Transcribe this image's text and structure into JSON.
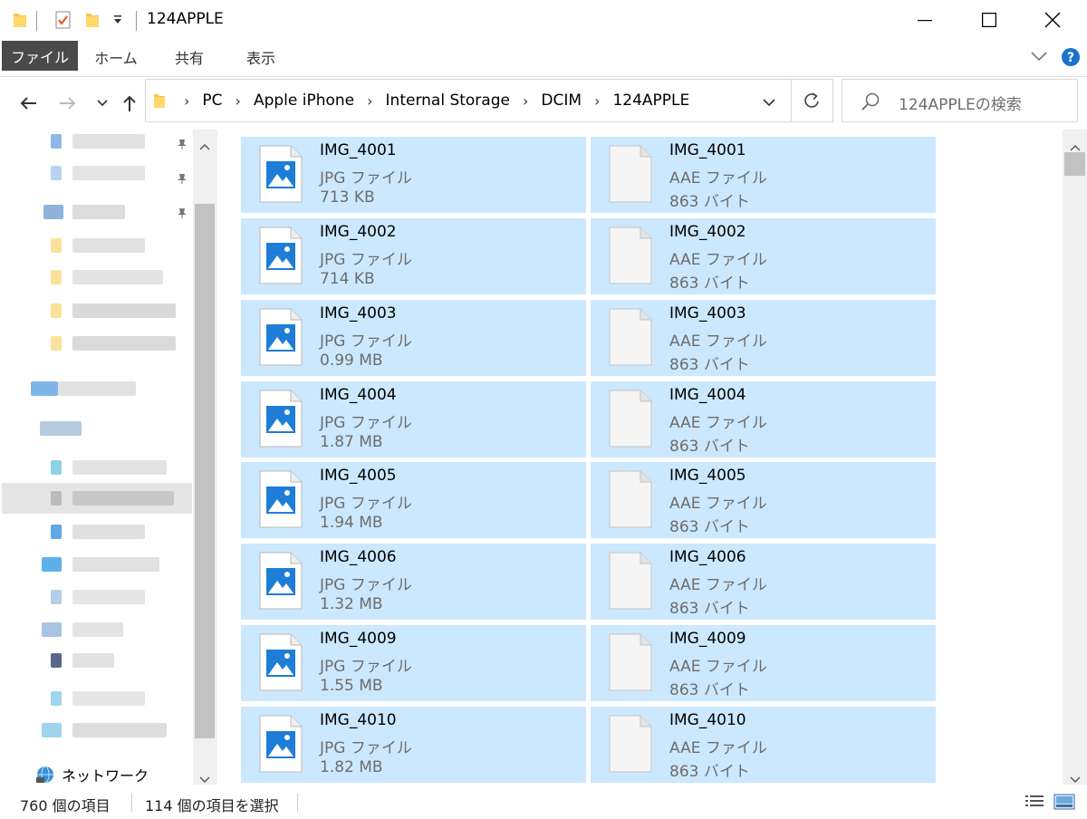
{
  "window": {
    "title": "124APPLE"
  },
  "ribbon": {
    "tabs": [
      "ファイル",
      "ホーム",
      "共有",
      "表示"
    ]
  },
  "address": {
    "crumbs": [
      "PC",
      "Apple iPhone",
      "Internal Storage",
      "DCIM",
      "124APPLE"
    ]
  },
  "search": {
    "placeholder": "124APPLEの検索"
  },
  "nav": {
    "network_label": "ネットワーク"
  },
  "files": [
    {
      "name": "IMG_4001",
      "type": "JPG ファイル",
      "size": "713 KB",
      "kind": "image"
    },
    {
      "name": "IMG_4001",
      "type": "AAE ファイル",
      "size": "863 バイト",
      "kind": "doc"
    },
    {
      "name": "IMG_4002",
      "type": "JPG ファイル",
      "size": "714 KB",
      "kind": "image"
    },
    {
      "name": "IMG_4002",
      "type": "AAE ファイル",
      "size": "863 バイト",
      "kind": "doc"
    },
    {
      "name": "IMG_4003",
      "type": "JPG ファイル",
      "size": "0.99 MB",
      "kind": "image"
    },
    {
      "name": "IMG_4003",
      "type": "AAE ファイル",
      "size": "863 バイト",
      "kind": "doc"
    },
    {
      "name": "IMG_4004",
      "type": "JPG ファイル",
      "size": "1.87 MB",
      "kind": "image"
    },
    {
      "name": "IMG_4004",
      "type": "AAE ファイル",
      "size": "863 バイト",
      "kind": "doc"
    },
    {
      "name": "IMG_4005",
      "type": "JPG ファイル",
      "size": "1.94 MB",
      "kind": "image"
    },
    {
      "name": "IMG_4005",
      "type": "AAE ファイル",
      "size": "863 バイト",
      "kind": "doc"
    },
    {
      "name": "IMG_4006",
      "type": "JPG ファイル",
      "size": "1.32 MB",
      "kind": "image"
    },
    {
      "name": "IMG_4006",
      "type": "AAE ファイル",
      "size": "863 バイト",
      "kind": "doc"
    },
    {
      "name": "IMG_4009",
      "type": "JPG ファイル",
      "size": "1.55 MB",
      "kind": "image"
    },
    {
      "name": "IMG_4009",
      "type": "AAE ファイル",
      "size": "863 バイト",
      "kind": "doc"
    },
    {
      "name": "IMG_4010",
      "type": "JPG ファイル",
      "size": "1.82 MB",
      "kind": "image"
    },
    {
      "name": "IMG_4010",
      "type": "AAE ファイル",
      "size": "863 バイト",
      "kind": "doc"
    }
  ],
  "status": {
    "item_count": "760 個の項目",
    "selected_count": "114 個の項目を選択"
  },
  "colors": {
    "selection": "#cce8ff",
    "ribbon_file_tab": "#4a4a4a",
    "help_icon": "#1a73c9",
    "image_icon_blue": "#1e7dd7"
  }
}
